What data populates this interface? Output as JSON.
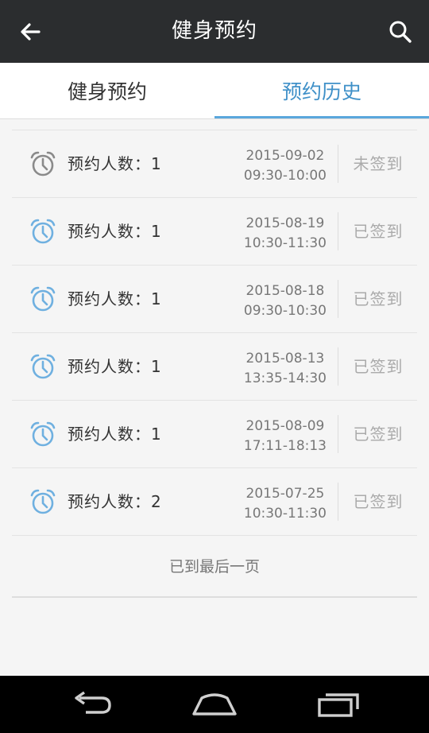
{
  "appbar": {
    "title": "健身预约",
    "back_icon": "arrow-left-icon",
    "search_icon": "search-icon"
  },
  "tabs": [
    {
      "label": "健身预约",
      "active": false
    },
    {
      "label": "预约历史",
      "active": true
    }
  ],
  "colors": {
    "appbar_bg": "#2b2d2f",
    "accent": "#3f90c8",
    "clock_gray": "#8a8a8a",
    "clock_blue": "#6fb0e0",
    "status_text": "#aaaaaa"
  },
  "list": {
    "items": [
      {
        "count_label": "预约人数：1",
        "date": "2015-09-02",
        "time": "09:30-10:00",
        "status": "未签到",
        "icon": "alarm-clock-icon",
        "icon_color": "gray"
      },
      {
        "count_label": "预约人数：1",
        "date": "2015-08-19",
        "time": "10:30-11:30",
        "status": "已签到",
        "icon": "alarm-clock-icon",
        "icon_color": "blue"
      },
      {
        "count_label": "预约人数：1",
        "date": "2015-08-18",
        "time": "09:30-10:30",
        "status": "已签到",
        "icon": "alarm-clock-icon",
        "icon_color": "blue"
      },
      {
        "count_label": "预约人数：1",
        "date": "2015-08-13",
        "time": "13:35-14:30",
        "status": "已签到",
        "icon": "alarm-clock-icon",
        "icon_color": "blue"
      },
      {
        "count_label": "预约人数：1",
        "date": "2015-08-09",
        "time": "17:11-18:13",
        "status": "已签到",
        "icon": "alarm-clock-icon",
        "icon_color": "blue"
      },
      {
        "count_label": "预约人数：2",
        "date": "2015-07-25",
        "time": "10:30-11:30",
        "status": "已签到",
        "icon": "alarm-clock-icon",
        "icon_color": "blue"
      }
    ],
    "end_message": "已到最后一页"
  },
  "navbar": {
    "back_icon": "nav-back-icon",
    "home_icon": "nav-home-icon",
    "recents_icon": "nav-recents-icon"
  }
}
